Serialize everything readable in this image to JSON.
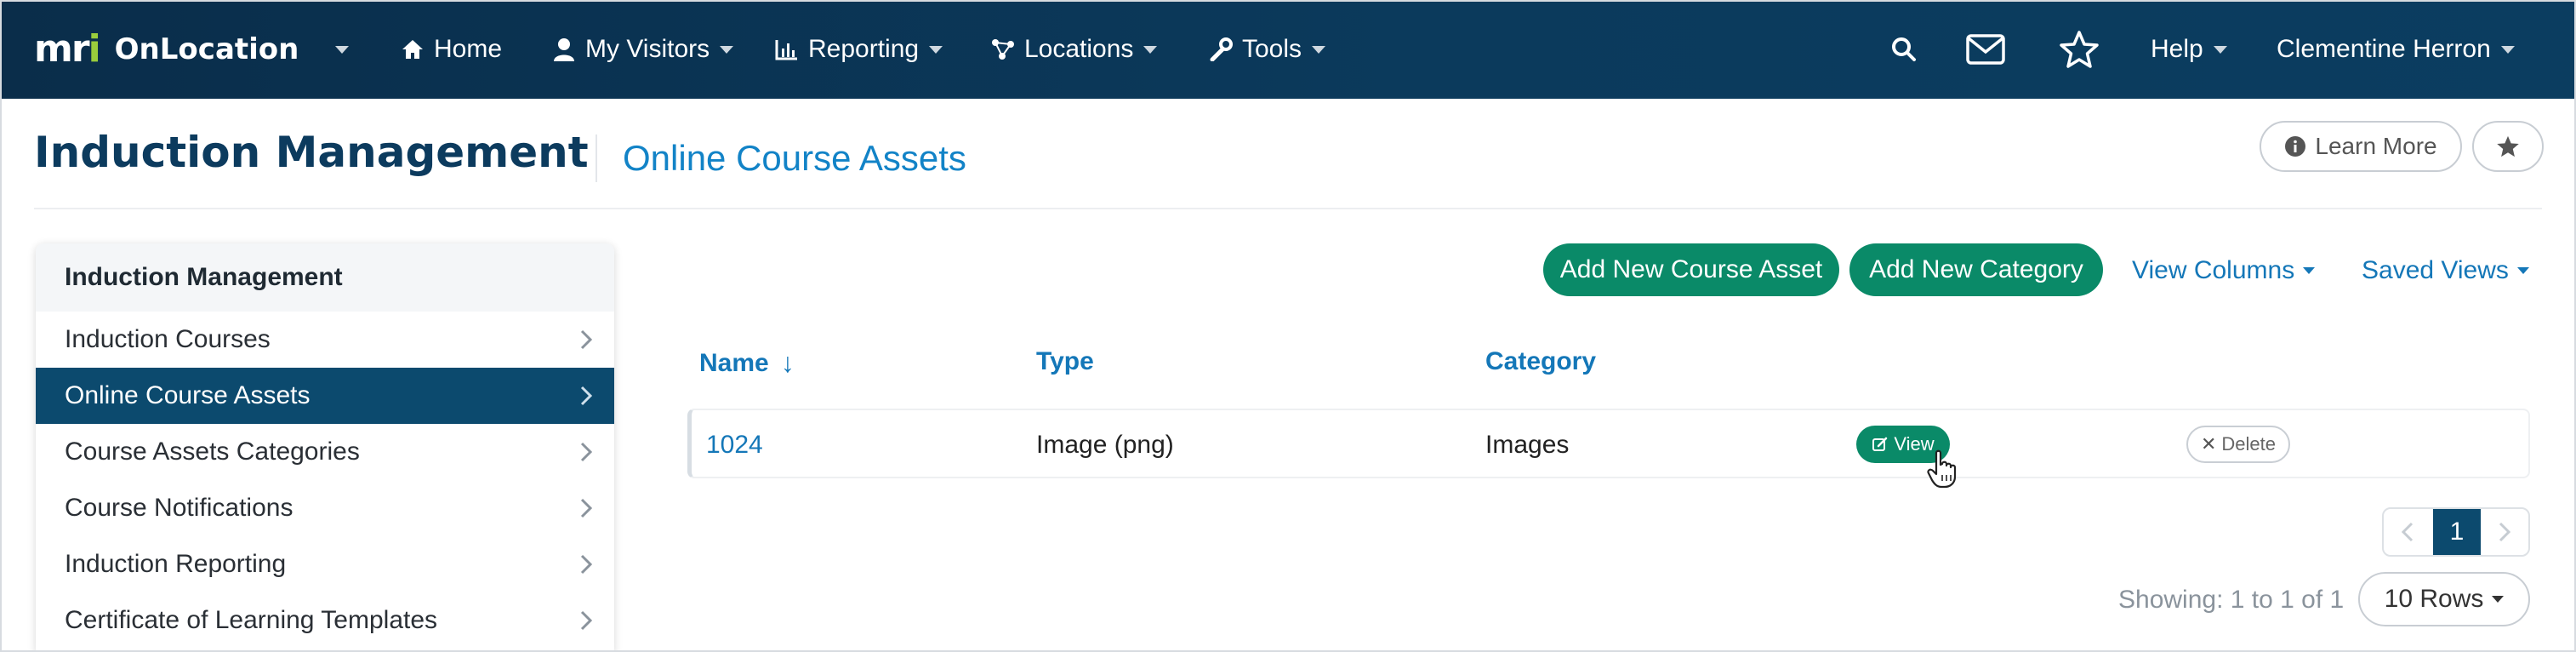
{
  "app": {
    "logo_mark": "mri",
    "logo_text": "OnLocation"
  },
  "nav": {
    "items": [
      {
        "label": "Home",
        "icon": "home-icon"
      },
      {
        "label": "My Visitors",
        "icon": "user-icon"
      },
      {
        "label": "Reporting",
        "icon": "bar-chart-icon"
      },
      {
        "label": "Locations",
        "icon": "network-icon"
      },
      {
        "label": "Tools",
        "icon": "wrench-icon"
      }
    ],
    "help": "Help",
    "user": "Clementine Herron"
  },
  "header": {
    "title": "Induction Management",
    "subtitle": "Online Course Assets",
    "learn_more": "Learn More"
  },
  "sidebar": {
    "heading": "Induction Management",
    "items": [
      {
        "label": "Induction Courses",
        "active": false
      },
      {
        "label": "Online Course Assets",
        "active": true
      },
      {
        "label": "Course Assets Categories",
        "active": false
      },
      {
        "label": "Course Notifications",
        "active": false
      },
      {
        "label": "Induction Reporting",
        "active": false
      },
      {
        "label": "Certificate of Learning Templates",
        "active": false
      }
    ]
  },
  "toolbar": {
    "add_asset": "Add New Course Asset",
    "add_category": "Add New Category",
    "view_columns": "View Columns",
    "saved_views": "Saved Views"
  },
  "table": {
    "columns": [
      "Name",
      "Type",
      "Category"
    ],
    "sort_indicator": "↓",
    "rows": [
      {
        "name": "1024",
        "type": "Image (png)",
        "category": "Images",
        "view": "View",
        "delete": "Delete"
      }
    ]
  },
  "pagination": {
    "current_page": "1",
    "showing": "Showing: 1 to 1 of 1",
    "rows_per_page": "10 Rows"
  },
  "colors": {
    "nav_bg": "#0b3a5c",
    "brand_green": "#0a8a68",
    "active_item": "#0c4a6e",
    "link_blue": "#1477b8",
    "logo_accent": "#9acd3c"
  }
}
